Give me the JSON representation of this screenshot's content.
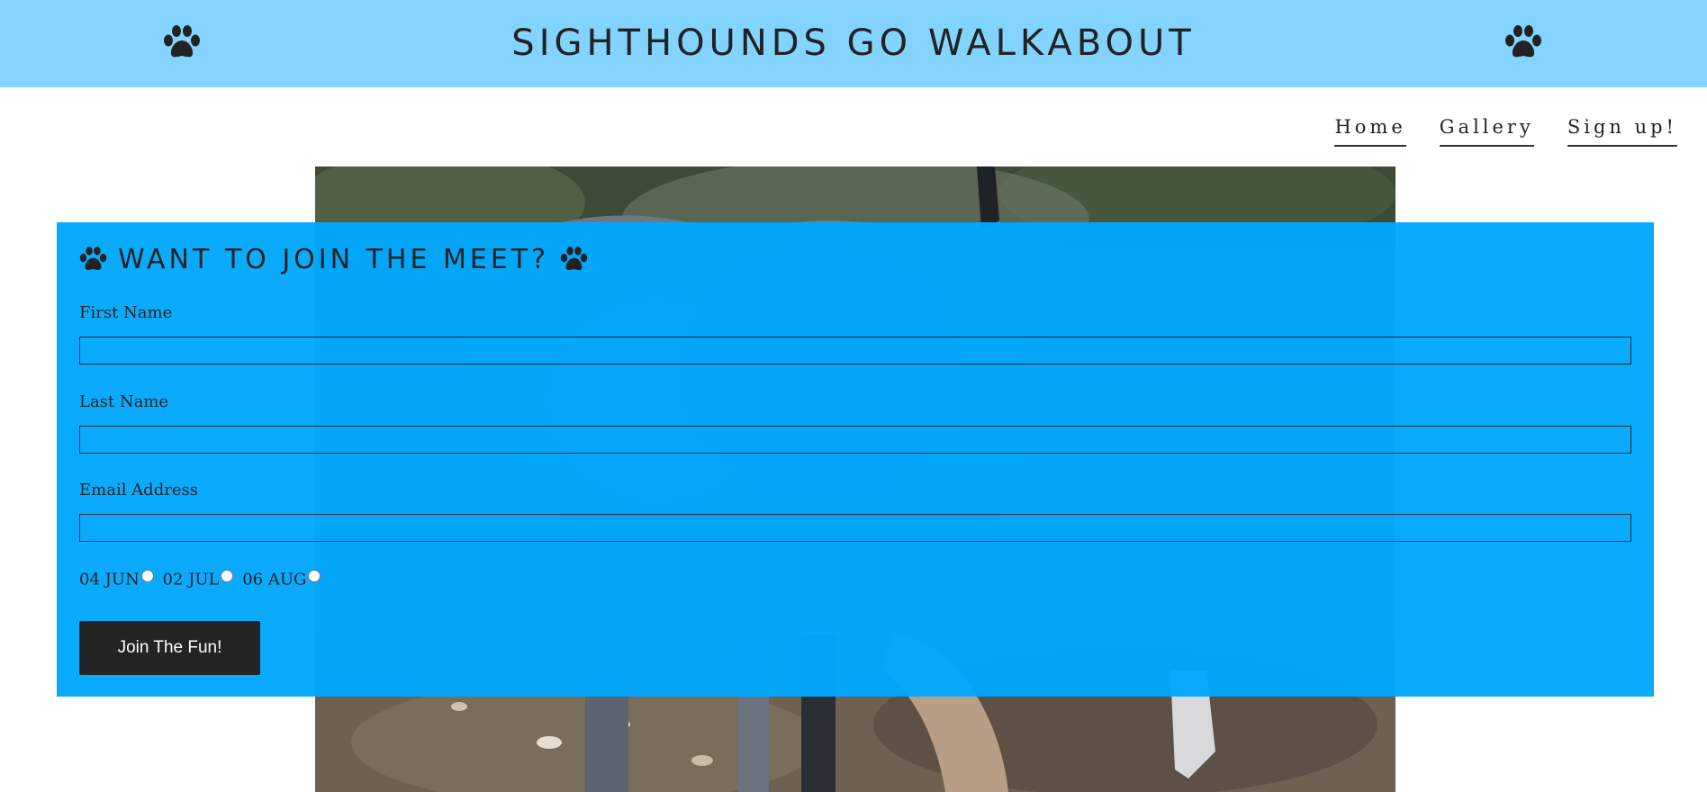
{
  "header": {
    "title": "SIGHTHOUNDS GO WALKABOUT",
    "left_icon": "paw-icon",
    "right_icon": "paw-icon",
    "background": "#82d3fd"
  },
  "nav": {
    "items": [
      {
        "label": "Home"
      },
      {
        "label": "Gallery"
      },
      {
        "label": "Sign up!"
      }
    ]
  },
  "hero": {
    "icon": "dog-photo"
  },
  "form": {
    "heading": "WANT TO JOIN THE MEET?",
    "heading_icon": "paw-icon",
    "panel_color": "#00a8ff",
    "fields": {
      "first_name": {
        "label": "First Name",
        "value": ""
      },
      "last_name": {
        "label": "Last Name",
        "value": ""
      },
      "email": {
        "label": "Email Address",
        "value": ""
      }
    },
    "dates": [
      {
        "label": "04 JUN",
        "selected": false
      },
      {
        "label": "02 JUL",
        "selected": false
      },
      {
        "label": "06 AUG",
        "selected": false
      }
    ],
    "submit_label": "Join The Fun!",
    "button_color": "#242424"
  }
}
